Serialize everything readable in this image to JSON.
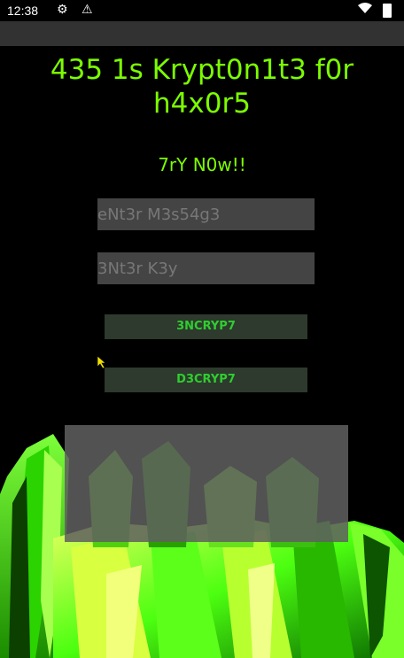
{
  "status": {
    "time": "12:38",
    "icons": [
      "gear-icon",
      "warning-icon",
      "wifi-icon",
      "battery-icon"
    ]
  },
  "app": {
    "title": "435 1s Krypt0n1t3 f0r h4x0r5",
    "subtitle": "7rY N0w!!"
  },
  "form": {
    "message_placeholder": "eNt3r M3s54g3",
    "key_placeholder": "3Nt3r K3y",
    "message_value": "",
    "key_value": ""
  },
  "buttons": {
    "encrypt": "3NCRYP7",
    "decrypt": "D3CRYP7"
  },
  "colors": {
    "accent": "#7CFC00",
    "button_text": "#2fce2f",
    "background": "#000000"
  }
}
